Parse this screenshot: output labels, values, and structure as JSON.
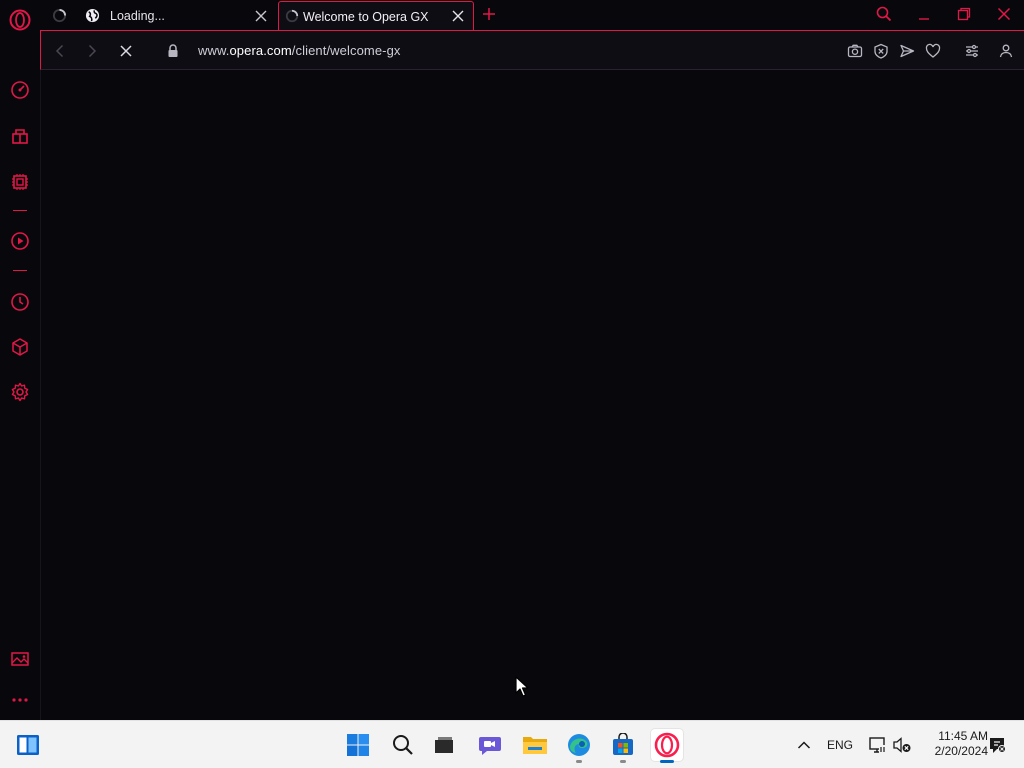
{
  "browser": {
    "name": "Opera GX",
    "accent_color": "#e01848",
    "background_color": "#08070b"
  },
  "tabs": [
    {
      "title": "Loading...",
      "active": false,
      "favicon": "globe-icon",
      "state": "loading"
    },
    {
      "title": "Welcome to Opera GX",
      "active": true,
      "favicon": "loading-spinner-icon",
      "state": "loading"
    }
  ],
  "address_bar": {
    "url_prefix": "www.",
    "url_domain": "opera.com",
    "url_path": "/client/welcome-gx",
    "secure": true
  },
  "toolbar_icons": [
    "back-icon",
    "forward-icon",
    "stop-loading-icon",
    "lock-icon",
    "snapshot-camera-icon",
    "adblock-shield-icon",
    "send-icon",
    "bookmark-heart-icon",
    "easy-setup-icon",
    "profile-icon"
  ],
  "sidebar_icons": [
    "opera-logo-icon",
    "gx-control-icon",
    "gx-corner-icon",
    "hot-tabs-killer-icon",
    "player-icon",
    "history-icon",
    "extensions-cube-icon",
    "settings-gear-icon",
    "wallpaper-icon",
    "more-icon"
  ],
  "taskbar": {
    "apps": [
      "start-icon",
      "search-icon",
      "task-view-icon",
      "chat-icon",
      "file-explorer-icon",
      "edge-icon",
      "store-icon",
      "opera-gx-icon"
    ],
    "active_app": "opera-gx-icon",
    "language": "ENG",
    "time": "11:45 AM",
    "date": "2/20/2024"
  }
}
